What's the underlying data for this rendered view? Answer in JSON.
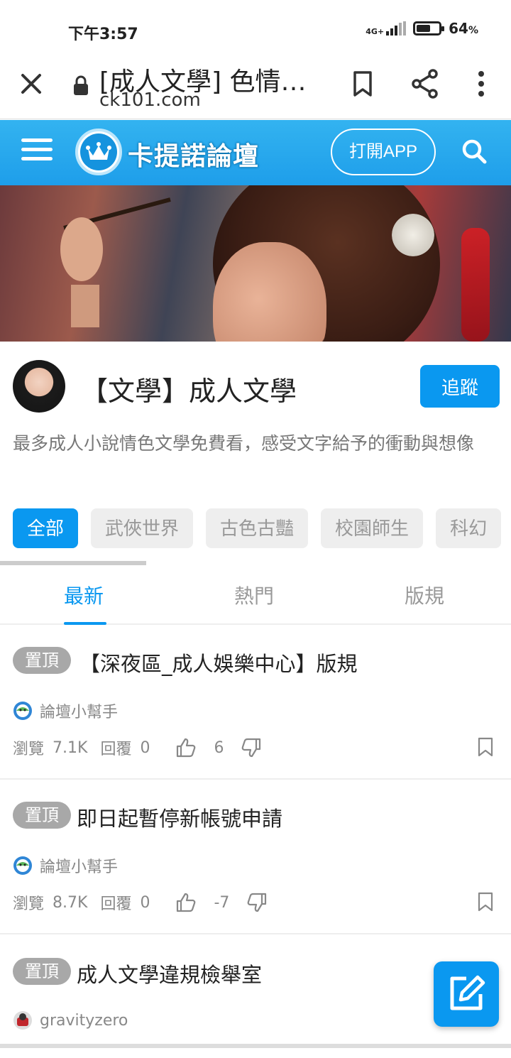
{
  "status_bar": {
    "time": "下午3:57",
    "network": "4G+",
    "battery_percent": "64",
    "battery_unit": "%",
    "battery_level": 0.64
  },
  "browser": {
    "page_title": "[成人文學] 色情…",
    "url": "ck101.com",
    "close_icon": "close-icon",
    "lock_icon": "lock-icon",
    "bookmark_icon": "bookmark-icon",
    "share_icon": "share-icon",
    "more_icon": "more-vert-icon"
  },
  "site_header": {
    "brand": "卡提諾論壇",
    "open_app_label": "打開APP",
    "accent_color": "#1e9eea"
  },
  "forum": {
    "title": "【文學】成人文學",
    "follow_label": "追蹤",
    "description": "最多成人小說情色文學免費看，感受文字給予的衝動與想像"
  },
  "categories": [
    {
      "label": "全部",
      "active": true
    },
    {
      "label": "武俠世界",
      "active": false
    },
    {
      "label": "古色古豔",
      "active": false
    },
    {
      "label": "校園師生",
      "active": false
    },
    {
      "label": "科幻",
      "active": false
    }
  ],
  "tabs": [
    {
      "label": "最新",
      "active": true
    },
    {
      "label": "熱門",
      "active": false
    },
    {
      "label": "版規",
      "active": false
    }
  ],
  "posts": [
    {
      "badge": "置頂",
      "title": "【深夜區_成人娛樂中心】版規",
      "author": "論壇小幫手",
      "views_label": "瀏覽",
      "views": "7.1K",
      "replies_label": "回覆",
      "replies": "0",
      "likes": "6"
    },
    {
      "badge": "置頂",
      "title": "即日起暫停新帳號申請",
      "author": "論壇小幫手",
      "views_label": "瀏覽",
      "views": "8.7K",
      "replies_label": "回覆",
      "replies": "0",
      "likes": "-7"
    },
    {
      "badge": "置頂",
      "title": "成人文學違規檢舉室",
      "author": "gravityzero"
    }
  ],
  "fab": {
    "icon": "edit-icon"
  }
}
